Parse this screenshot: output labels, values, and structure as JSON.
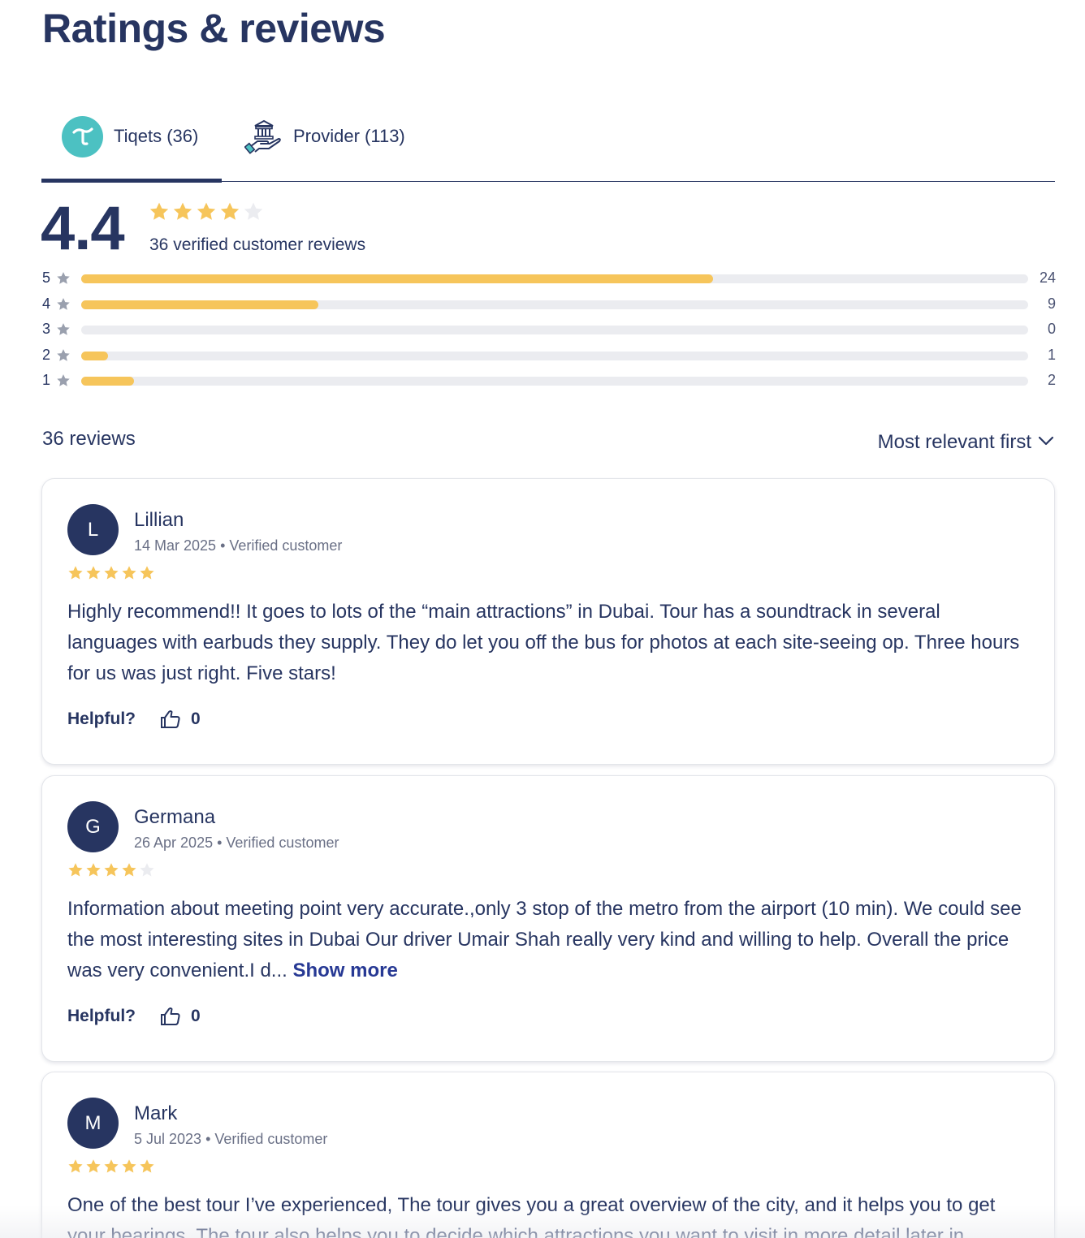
{
  "page": {
    "title": "Ratings & reviews"
  },
  "tabs": [
    {
      "label": "Tiqets (36)",
      "icon": "tiqets-logo-icon"
    },
    {
      "label": "Provider (113)",
      "icon": "provider-building-hand-icon"
    }
  ],
  "summary": {
    "score": "4.4",
    "star_rating": 4.4,
    "verified_count_text": "36 verified customer reviews"
  },
  "distribution": [
    {
      "stars": "5",
      "count": "24",
      "fraction": 0.667
    },
    {
      "stars": "4",
      "count": "9",
      "fraction": 0.25
    },
    {
      "stars": "3",
      "count": "0",
      "fraction": 0
    },
    {
      "stars": "2",
      "count": "1",
      "fraction": 0.028
    },
    {
      "stars": "1",
      "count": "2",
      "fraction": 0.056
    }
  ],
  "reviews_header": {
    "total": "36 reviews",
    "sort_label": "Most relevant first"
  },
  "reviews": [
    {
      "initial": "L",
      "name": "Lillian",
      "meta": "14 Mar 2025 • Verified customer",
      "rating": 5,
      "text": "Highly recommend!! It goes to lots of the “main attractions” in Dubai. Tour has a soundtrack in several languages with earbuds they supply. They do let you off the bus for photos at each site-seeing op. Three hours for us was just right. Five stars!",
      "show_more": "",
      "helpful_label": "Helpful?",
      "helpful_count": "0"
    },
    {
      "initial": "G",
      "name": "Germana",
      "meta": "26 Apr 2025 • Verified customer",
      "rating": 4,
      "text": "Information about meeting point very accurate.,only 3 stop of the metro from the airport (10 min). We could see the most interesting sites in Dubai Our driver Umair Shah really very kind and willing to help. Overall the price was very convenient.I d...",
      "show_more": "Show more",
      "helpful_label": "Helpful?",
      "helpful_count": "0"
    },
    {
      "initial": "M",
      "name": "Mark",
      "meta": "5 Jul 2023 • Verified customer",
      "rating": 5,
      "text": "One of the best tour I’ve experienced, The tour gives you a great overview of the city, and it helps you to get your bearings. The tour also helps you to decide which attractions you want to visit in more detail later in",
      "show_more": "",
      "helpful_label": "Helpful?",
      "helpful_count": "0"
    }
  ],
  "colors": {
    "primary": "#273561",
    "star": "#f6c55b",
    "star_empty": "#ebecf0",
    "tiqets_teal": "#4cc1c2",
    "link": "#273994"
  }
}
